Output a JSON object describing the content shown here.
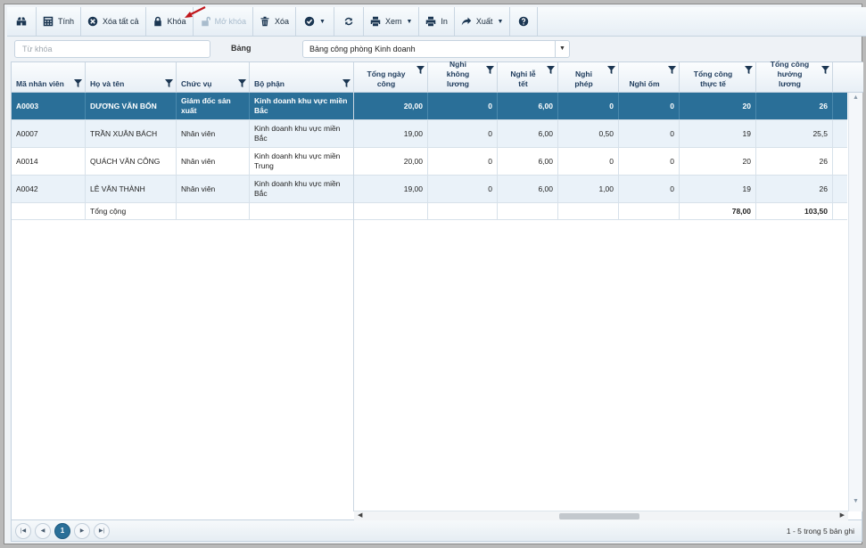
{
  "toolbar": {
    "calc_label": "Tính",
    "clear_all_label": "Xóa tất cả",
    "lock_label": "Khóa",
    "unlock_label": "Mở khóa",
    "delete_label": "Xóa",
    "view_label": "Xem",
    "print_label": "In",
    "export_label": "Xuất"
  },
  "filter": {
    "keyword_placeholder": "Từ khóa",
    "keyword_value": "",
    "table_label": "Bảng",
    "table_selected": "Bảng công phòng Kinh doanh"
  },
  "columns": [
    "Mã nhân viên",
    "Họ và tên",
    "Chức vụ",
    "Bộ phận",
    "Tổng ngày công",
    "Nghỉ không lương",
    "Nghỉ lễ tết",
    "Nghỉ phép",
    "Nghỉ ốm",
    "Tổng công thực tế",
    "Tổng công hưởng lương"
  ],
  "rows": [
    {
      "id": "A0003",
      "name": "DƯƠNG VĂN BỐN",
      "position": "Giám đốc sản xuất",
      "dept": "Kinh doanh khu vực miền Bắc",
      "total_days": "20,00",
      "unpaid": "0",
      "holiday": "6,00",
      "leave": "0",
      "sick": "0",
      "actual": "20",
      "paid": "26"
    },
    {
      "id": "A0007",
      "name": "TRẦN XUÂN BÁCH",
      "position": "Nhân viên",
      "dept": "Kinh doanh khu vực miền Bắc",
      "total_days": "19,00",
      "unpaid": "0",
      "holiday": "6,00",
      "leave": "0,50",
      "sick": "0",
      "actual": "19",
      "paid": "25,5"
    },
    {
      "id": "A0014",
      "name": "QUÁCH VĂN CÔNG",
      "position": "Nhân viên",
      "dept": "Kinh doanh khu vực miền Trung",
      "total_days": "20,00",
      "unpaid": "0",
      "holiday": "6,00",
      "leave": "0",
      "sick": "0",
      "actual": "20",
      "paid": "26"
    },
    {
      "id": "A0042",
      "name": "LÊ VĂN THÀNH",
      "position": "Nhân viên",
      "dept": "Kinh doanh khu vực miền Bắc",
      "total_days": "19,00",
      "unpaid": "0",
      "holiday": "6,00",
      "leave": "1,00",
      "sick": "0",
      "actual": "19",
      "paid": "26"
    }
  ],
  "totals": {
    "label": "Tổng cộng",
    "actual": "78,00",
    "paid": "103,50"
  },
  "pager": {
    "current_page": "1",
    "info": "1 - 5 trong 5 bản ghi"
  },
  "icons": [
    "binoculars-icon",
    "calculator-icon",
    "clear-icon",
    "lock-icon",
    "unlock-icon",
    "trash-icon",
    "check-icon",
    "refresh-icon",
    "view-icon",
    "print-icon",
    "export-icon",
    "help-icon"
  ],
  "colors": {
    "selected_row": "#2a6f98",
    "alt_row": "#eaf2f9",
    "header_text": "#1e3b5c",
    "annotation_arrow": "#c0161b"
  }
}
